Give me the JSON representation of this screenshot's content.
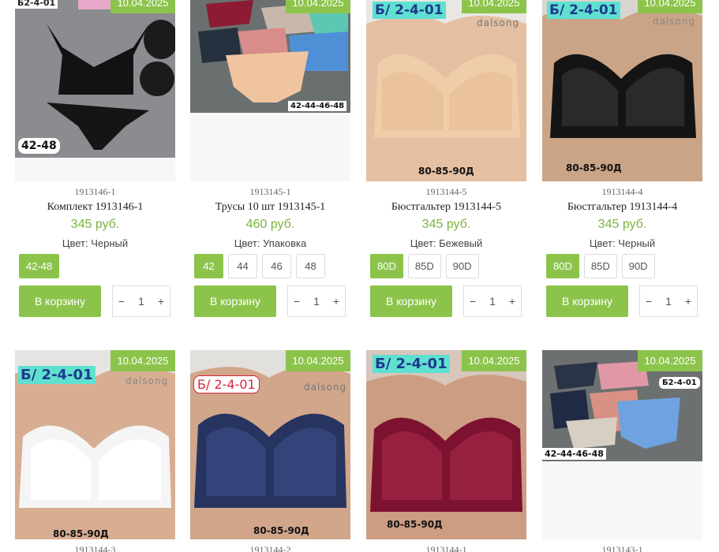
{
  "cart_label": "В корзину",
  "colors": {
    "accent": "#8cc44b",
    "price": "#7cb342"
  },
  "products": [
    {
      "sku": "1913146-1",
      "title": "Комплект 1913146-1",
      "price": "345 руб.",
      "color": "Цвет: Черный",
      "date": "10.04.2025",
      "sizes": [
        "42-48"
      ],
      "qty": "1",
      "stickers": {
        "top": "Б2-4-01",
        "bottom": "42-48"
      }
    },
    {
      "sku": "1913145-1",
      "title": "Трусы 10 шт 1913145-1",
      "price": "460 руб.",
      "color": "Цвет: Упаковка",
      "date": "10.04.2025",
      "sizes": [
        "42",
        "44",
        "46",
        "48"
      ],
      "qty": "1",
      "stickers": {
        "bottom": "42-44-46-48"
      }
    },
    {
      "sku": "1913144-5",
      "title": "Бюстгальтер 1913144-5",
      "price": "345 руб.",
      "color": "Цвет: Бежевый",
      "date": "10.04.2025",
      "sizes": [
        "80D",
        "85D",
        "90D"
      ],
      "qty": "1",
      "stickers": {
        "top": "Б/ 2-4-01",
        "brand": "dalsong",
        "bottom": "80-85-90Д"
      }
    },
    {
      "sku": "1913144-4",
      "title": "Бюстгальтер 1913144-4",
      "price": "345 руб.",
      "color": "Цвет: Черный",
      "date": "10.04.2025",
      "sizes": [
        "80D",
        "85D",
        "90D"
      ],
      "qty": "1",
      "stickers": {
        "top": "Б/ 2-4-01",
        "brand": "dalsong",
        "bottom": "80-85-90Д"
      }
    },
    {
      "sku": "1913144-3",
      "date": "10.04.2025",
      "stickers": {
        "top": "Б/ 2-4-01",
        "brand": "dalsong",
        "bottom": "80-85-90Д"
      }
    },
    {
      "sku": "1913144-2",
      "date": "10.04.2025",
      "stickers": {
        "top": "Б/ 2-4-01",
        "brand": "dalsong",
        "bottom": "80-85-90Д"
      }
    },
    {
      "sku": "1913144-1",
      "date": "10.04.2025",
      "stickers": {
        "top": "Б/ 2-4-01",
        "bottom": "80-85-90Д"
      }
    },
    {
      "sku": "1913143-1",
      "date": "10.04.2025",
      "stickers": {
        "top": "Б2-4-01",
        "bottom": "42-44-46-48"
      }
    }
  ]
}
